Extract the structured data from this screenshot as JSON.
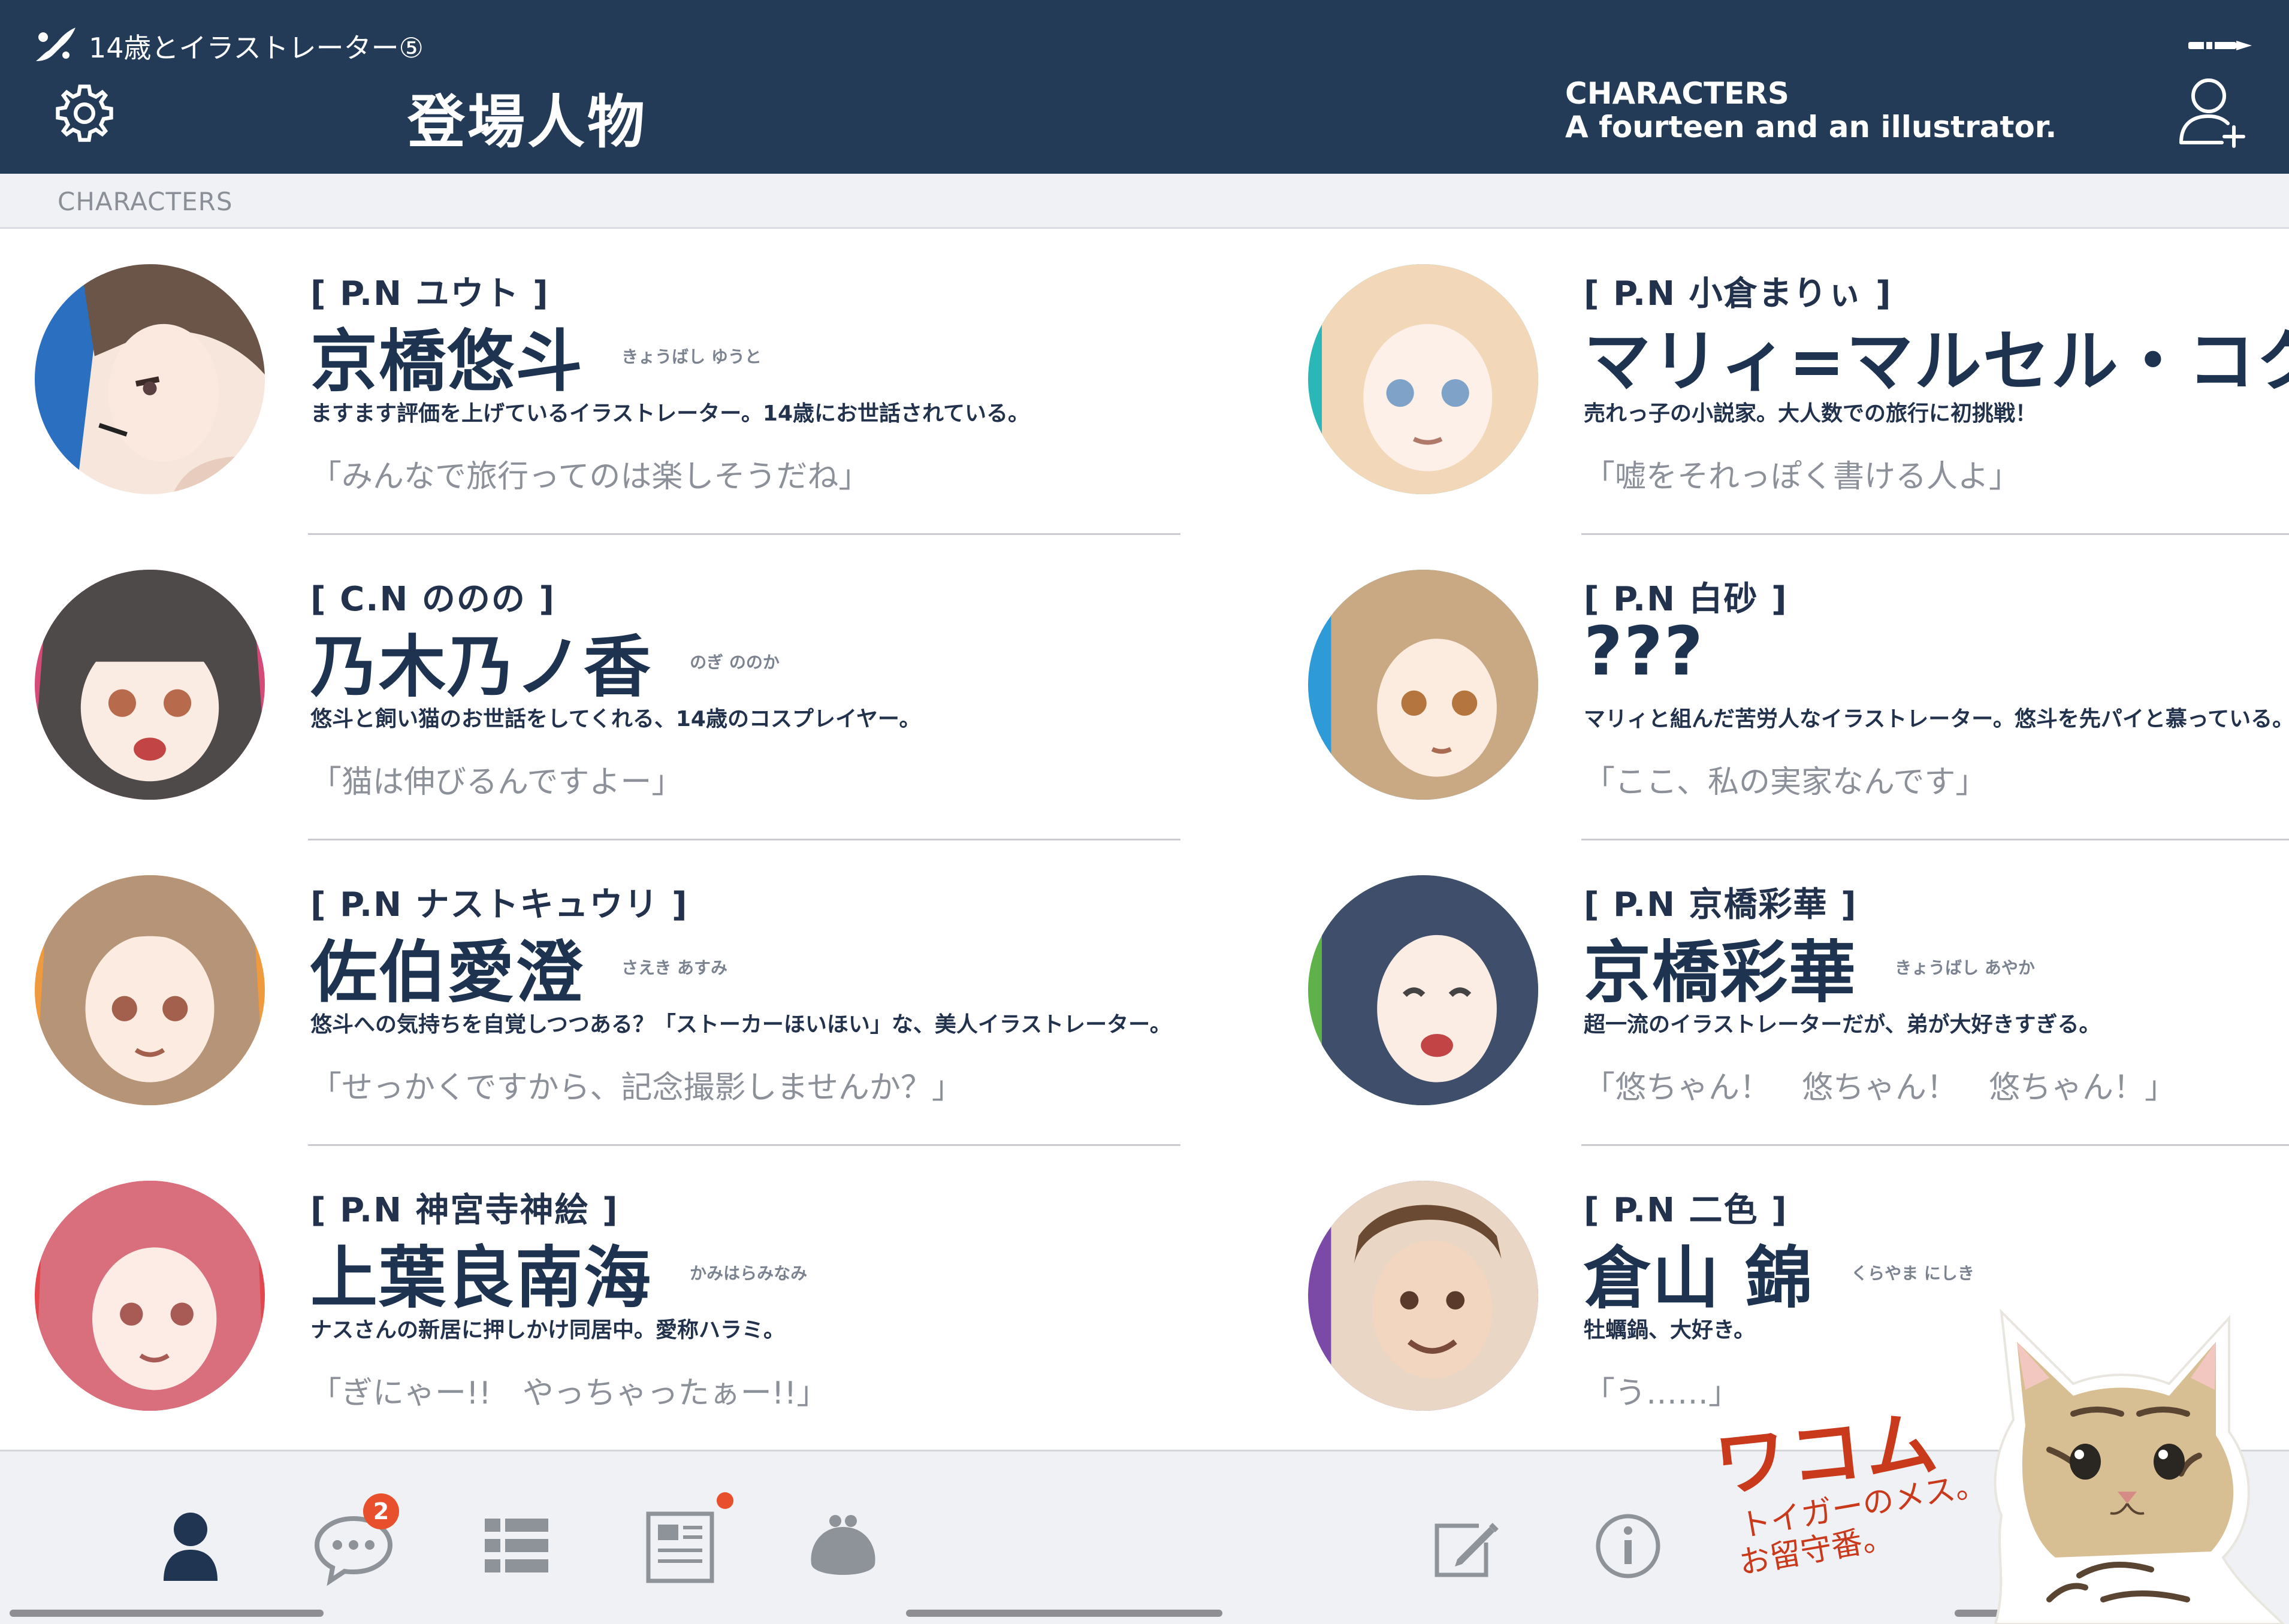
{
  "header": {
    "subtitle": "14歳とイラストレーター⑤",
    "title": "登場人物",
    "en_line1": "CHARACTERS",
    "en_line2": "A fourteen and an illustrator."
  },
  "section": {
    "label": "CHARACTERS"
  },
  "characters": [
    {
      "pn": "[ P.N ユウト ]",
      "name": "京橋悠斗",
      "ruby": "きょうばし ゆうと",
      "desc": "ますます評価を上げているイラストレーター。14歳にお世話されている。",
      "quote": "「みんなで旅行ってのは楽しそうだね」"
    },
    {
      "pn": "[ C.N ののの ]",
      "name": "乃木乃ノ香",
      "ruby": "のぎ ののか",
      "desc": "悠斗と飼い猫のお世話をしてくれる、14歳のコスプレイヤー。",
      "quote": "「猫は伸びるんですよー」"
    },
    {
      "pn": "[ P.N ナストキュウリ ]",
      "name": "佐伯愛澄",
      "ruby": "さえき あすみ",
      "desc": "悠斗への気持ちを自覚しつつある？「ストーカーほいほい」な、美人イラストレーター。",
      "quote": "「せっかくですから、記念撮影しませんか？」"
    },
    {
      "pn": "[ P.N 神宮寺神絵 ]",
      "name": "上葉良南海",
      "ruby": "かみはらみなみ",
      "desc": "ナスさんの新居に押しかけ同居中。愛称ハラミ。",
      "quote": "「ぎにゃー!!　やっちゃったぁー!!」"
    },
    {
      "pn": "[ P.N 小倉まりぃ ]",
      "name": "マリィ=マルセル・コクラ",
      "ruby": "",
      "desc": "売れっ子の小説家。大人数での旅行に初挑戦！",
      "quote": "「嘘をそれっぽく書ける人よ」"
    },
    {
      "pn": "[ P.N 白砂 ]",
      "name": "???",
      "ruby": "",
      "desc": "マリィと組んだ苦労人なイラストレーター。悠斗を先パイと慕っている。",
      "quote": "「ここ、私の実家なんです」"
    },
    {
      "pn": "[ P.N 京橋彩華 ]",
      "name": "京橋彩華",
      "ruby": "きょうばし あやか",
      "desc": "超一流のイラストレーターだが、弟が大好きすぎる。",
      "quote": "「悠ちゃん！　悠ちゃん！　悠ちゃん！」"
    },
    {
      "pn": "[ P.N 二色 ]",
      "name": "倉山 錦",
      "ruby": "くらやま にしき",
      "desc": "牡蠣鍋、大好き。",
      "quote": "「う……」"
    }
  ],
  "tabbar": {
    "messages_badge": "2"
  },
  "cat": {
    "name": "ワコム",
    "note1": "トイガーのメス。",
    "note2": "お留守番。"
  },
  "colors": {
    "header_bg": "#233b57",
    "accent_badge": "#e8502d",
    "name_text": "#1d3350",
    "cat_text": "#c9391c"
  }
}
